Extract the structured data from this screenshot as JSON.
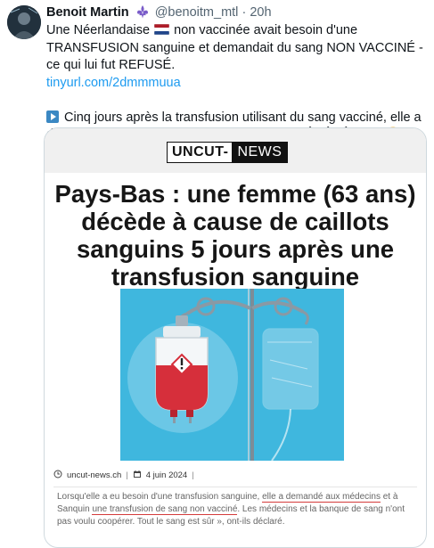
{
  "author": {
    "name": "Benoit Martin",
    "handle": "@benoitm_mtl",
    "dot": "·",
    "time": "20h"
  },
  "tweet": {
    "line1_a": "Une Néerlandaise",
    "line1_b": "non vaccinée avait besoin d'une TRANSFUSION sanguine et demandait du sang NON VACCINÉ - ce qui lui fut REFUSÉ.",
    "link": "tinyurl.com/2dmmmuua",
    "line2": "Cinq jours après la transfusion utilisant du sang vacciné, elle a développé une coagulation sanguine et est DÉCÉDÉE. 👀 😢"
  },
  "card": {
    "logo_left": "UNCUT-",
    "logo_right": "NEWS",
    "headline": "Pays-Bas : une femme (63 ans) décède à cause de caillots sanguins 5 jours après une transfusion sanguine",
    "meta_site": "uncut-news.ch",
    "meta_date": "4 juin 2024",
    "meta_sep": "|",
    "excerpt_1": "Lorsqu'elle a eu besoin d'une transfusion sanguine, ",
    "excerpt_u1": "elle a demandé aux médecins",
    "excerpt_2": " et à Sanquin ",
    "excerpt_u2": "une transfusion de sang non vacciné",
    "excerpt_3": ". Les médecins et la banque de sang n'ont pas voulu coopérer. Tout le sang est sûr », ont-ils déclaré."
  },
  "colors": {
    "link": "#1d9bf0",
    "muted": "#536471",
    "illustration_bg": "#3fb7de",
    "blood": "#d62f3b",
    "underline": "#d43b3b"
  },
  "icons": [
    "fleur-de-lis-icon",
    "netherlands-flag-icon",
    "play-button-icon",
    "eyes-emoji",
    "crying-face-emoji",
    "clock-icon",
    "calendar-icon"
  ]
}
